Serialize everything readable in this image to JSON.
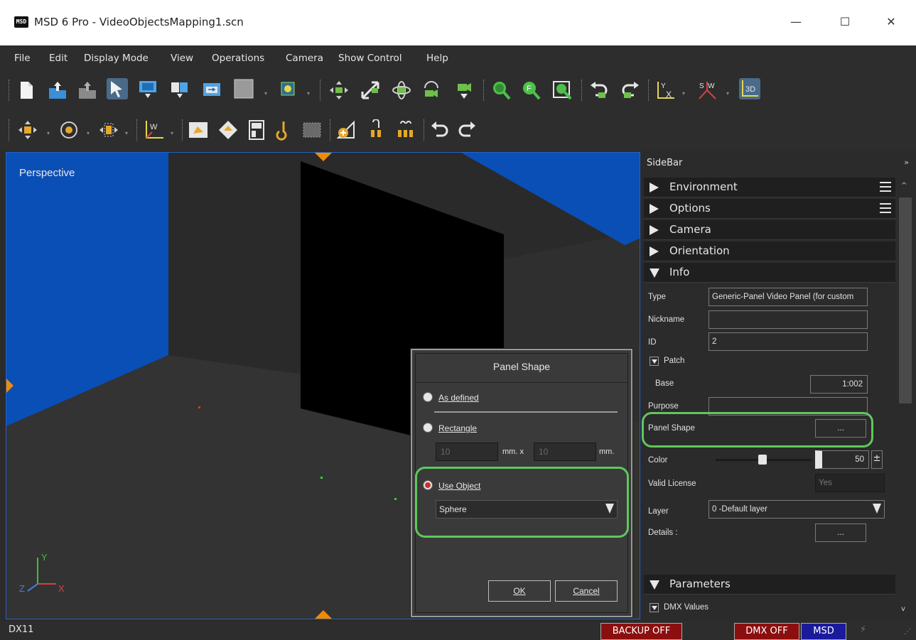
{
  "window": {
    "logo": "MSD",
    "title": "MSD 6 Pro - VideoObjectsMapping1.scn",
    "minimize_glyph": "—",
    "maximize_glyph": "☐",
    "close_glyph": "✕"
  },
  "menu": [
    "File",
    "Edit",
    "Display Mode",
    "View",
    "Operations",
    "Camera",
    "Show Control",
    "Help"
  ],
  "toolbar": {
    "axis_x_label": "X",
    "axis_y_label": "Y",
    "axis_w_label": "W",
    "axis_s_label": "S",
    "view_3d_label": "3D",
    "icons": [
      "new-file-icon",
      "open-folder-icon",
      "save-icon",
      "select-arrow-icon",
      "monitor-icon",
      "copy-icon",
      "window-icon",
      "box-icon",
      "fixture-icon",
      "pan-icon",
      "resize-icon",
      "orbit-icon",
      "camera-icon",
      "zoom-icon",
      "undo-icon",
      "redo-icon"
    ]
  },
  "viewport": {
    "label": "Perspective",
    "axis_x": "X",
    "axis_y": "Y",
    "axis_z": "Z"
  },
  "dialog": {
    "title": "Panel Shape",
    "option_as_defined": "As defined",
    "option_rectangle": "Rectangle",
    "width_value": "10",
    "height_value": "10",
    "unit_mm_x": "mm.  x",
    "unit_mm": "mm.",
    "option_use_object": "Use Object",
    "object_selected": "Sphere",
    "selected_option": "Use Object",
    "ok_label": "OK",
    "cancel_label": "Cancel"
  },
  "sidebar": {
    "title": "SideBar",
    "pin_glyph": "»",
    "sections": {
      "environment": "Environment",
      "options": "Options",
      "camera": "Camera",
      "orientation": "Orientation",
      "info": "Info",
      "parameters": "Parameters"
    },
    "info": {
      "type_label": "Type",
      "type_value": "Generic-Panel Video Panel (for custom",
      "nickname_label": "Nickname",
      "nickname_value": "",
      "id_label": "ID",
      "id_value": "2",
      "patch_label": "Patch",
      "base_label": "Base",
      "base_value": "1:002",
      "purpose_label": "Purpose",
      "purpose_value": "",
      "panel_shape_label": "Panel Shape",
      "panel_shape_button": "...",
      "color_label": "Color",
      "color_value": "50",
      "color_level": 0.5,
      "valid_license_label": "Valid License",
      "valid_license_value": "Yes",
      "layer_label": "Layer",
      "layer_value": "0 -Default layer",
      "details_label": "Details :",
      "details_button": "..."
    },
    "dmx_values_label": "DMX Values"
  },
  "status": {
    "renderer": "DX11",
    "backup": "BACKUP OFF",
    "dmx": "DMX OFF",
    "msd": "MSD",
    "colors": {
      "backup_bg": "#8b0f0f",
      "dmx_bg": "#8b0f0f",
      "msd_bg": "#1a1a9a"
    }
  },
  "colors": {
    "accent_highlight": "#5fc85a",
    "viewport_border": "#2660c9",
    "scene_blue": "#0a4fb5"
  }
}
